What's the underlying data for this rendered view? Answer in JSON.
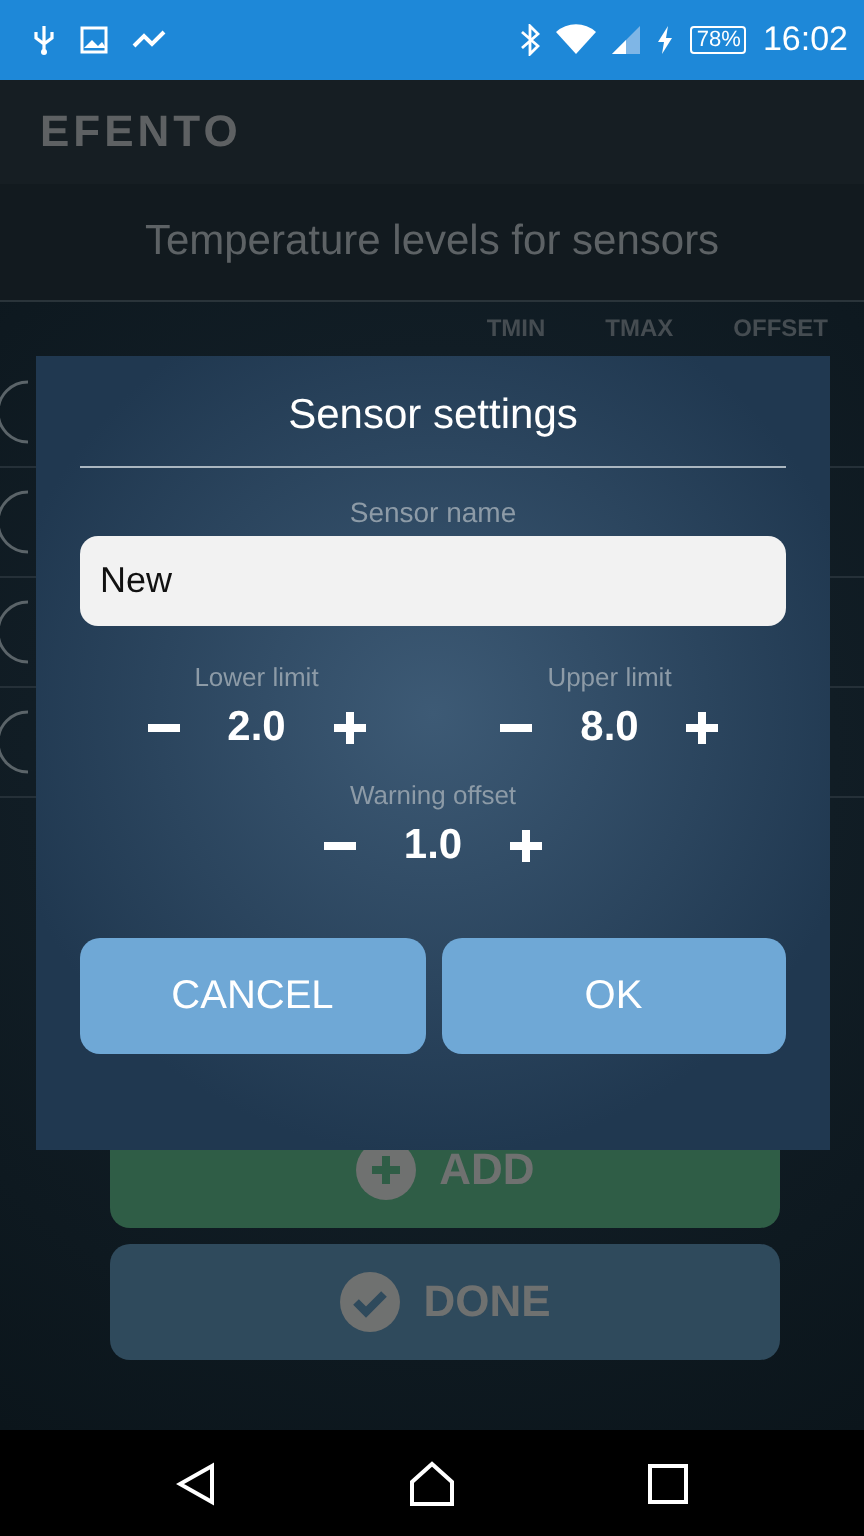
{
  "status_bar": {
    "battery": "78%",
    "time": "16:02"
  },
  "app_bar": {
    "title": "EFENTO"
  },
  "screen_title": "Temperature levels for sensors",
  "table": {
    "columns": [
      "TMIN",
      "TMAX",
      "OFFSET"
    ]
  },
  "dialog": {
    "title": "Sensor settings",
    "sensor_name": {
      "label": "Sensor name",
      "value": "New"
    },
    "steppers": [
      {
        "label": "Lower limit",
        "value": "2.0"
      },
      {
        "label": "Upper limit",
        "value": "8.0"
      },
      {
        "label": "Warning offset",
        "value": "1.0"
      }
    ],
    "buttons": [
      "CANCEL",
      "OK"
    ]
  },
  "actions": [
    {
      "kind": "add",
      "label": "ADD"
    },
    {
      "kind": "done",
      "label": "DONE"
    }
  ]
}
